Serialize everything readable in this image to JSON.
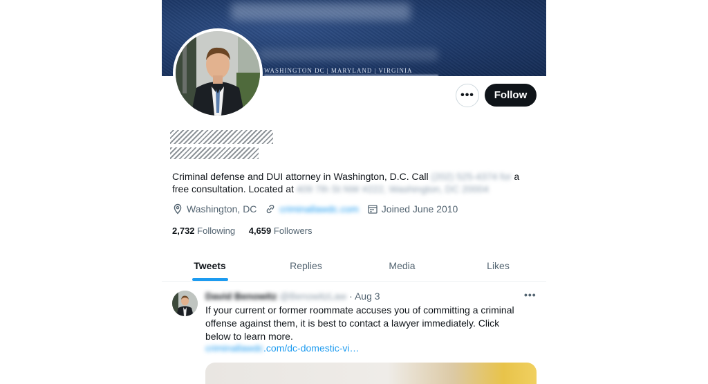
{
  "banner": {
    "tagline": "WASHINGTON DC  |  MARYLAND  |  VIRGINIA"
  },
  "actions": {
    "more_label": "•••",
    "follow_label": "Follow"
  },
  "profile": {
    "bio_prefix": "Criminal defense and DUI attorney in Washington, D.C. Call ",
    "bio_phone": "(202) 525-4374 for",
    "bio_mid": " a free consultation. Located at ",
    "bio_address": "409 7th St NW #222, Washington, DC 20004",
    "location": "Washington, DC",
    "website": "criminallawdc.com",
    "joined": "Joined June 2010",
    "following_count": "2,732",
    "following_label": "Following",
    "followers_count": "4,659",
    "followers_label": "Followers"
  },
  "tabs": [
    {
      "label": "Tweets",
      "active": true
    },
    {
      "label": "Replies",
      "active": false
    },
    {
      "label": "Media",
      "active": false
    },
    {
      "label": "Likes",
      "active": false
    }
  ],
  "tweet": {
    "author_name": "David Benowitz",
    "author_handle": "@BenowitzLaw",
    "date": "· Aug 3",
    "more_label": "•••",
    "text": "If your current or former roommate accuses you of committing a criminal offense against them, it is best to contact a lawyer immediately. Click below to learn more.",
    "link_domain": "criminallawdc",
    "link_path": ".com/dc-domestic-vi…"
  },
  "colors": {
    "accent": "#1d9bf0",
    "text": "#0f1419",
    "muted": "#536471",
    "follow_bg": "#0f1419"
  }
}
